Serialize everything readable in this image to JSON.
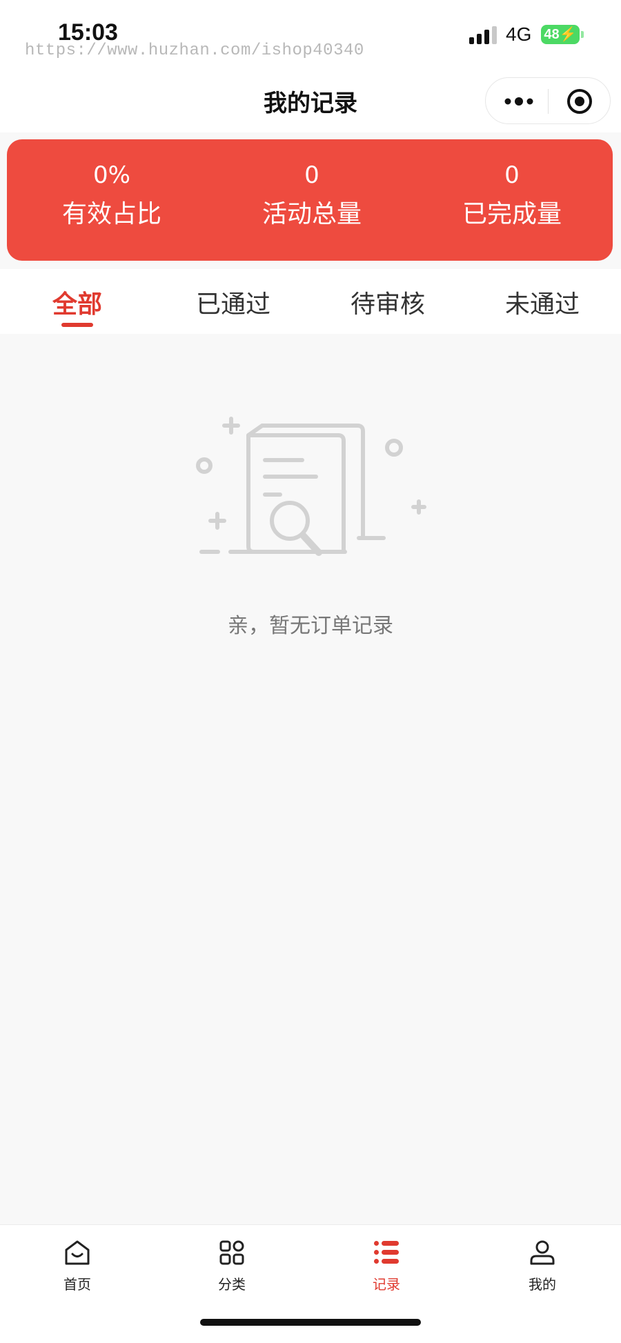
{
  "status_bar": {
    "time": "15:03",
    "watermark": "https://www.huzhan.com/ishop40340",
    "network": "4G",
    "battery": "48"
  },
  "header": {
    "title": "我的记录"
  },
  "stats": [
    {
      "value": "0%",
      "label": "有效占比"
    },
    {
      "value": "0",
      "label": "活动总量"
    },
    {
      "value": "0",
      "label": "已完成量"
    }
  ],
  "tabs": [
    {
      "label": "全部",
      "active": true
    },
    {
      "label": "已通过",
      "active": false
    },
    {
      "label": "待审核",
      "active": false
    },
    {
      "label": "未通过",
      "active": false
    }
  ],
  "empty_state": {
    "icon": "empty-document-search-icon",
    "message": "亲，暂无订单记录"
  },
  "bottom_nav": [
    {
      "label": "首页",
      "icon": "home-icon",
      "active": false
    },
    {
      "label": "分类",
      "icon": "grid-icon",
      "active": false
    },
    {
      "label": "记录",
      "icon": "list-icon",
      "active": true
    },
    {
      "label": "我的",
      "icon": "user-icon",
      "active": false
    }
  ],
  "colors": {
    "accent": "#e03a2f",
    "card": "#ee4b3f",
    "background": "#f8f8f8",
    "battery": "#4cd964"
  }
}
